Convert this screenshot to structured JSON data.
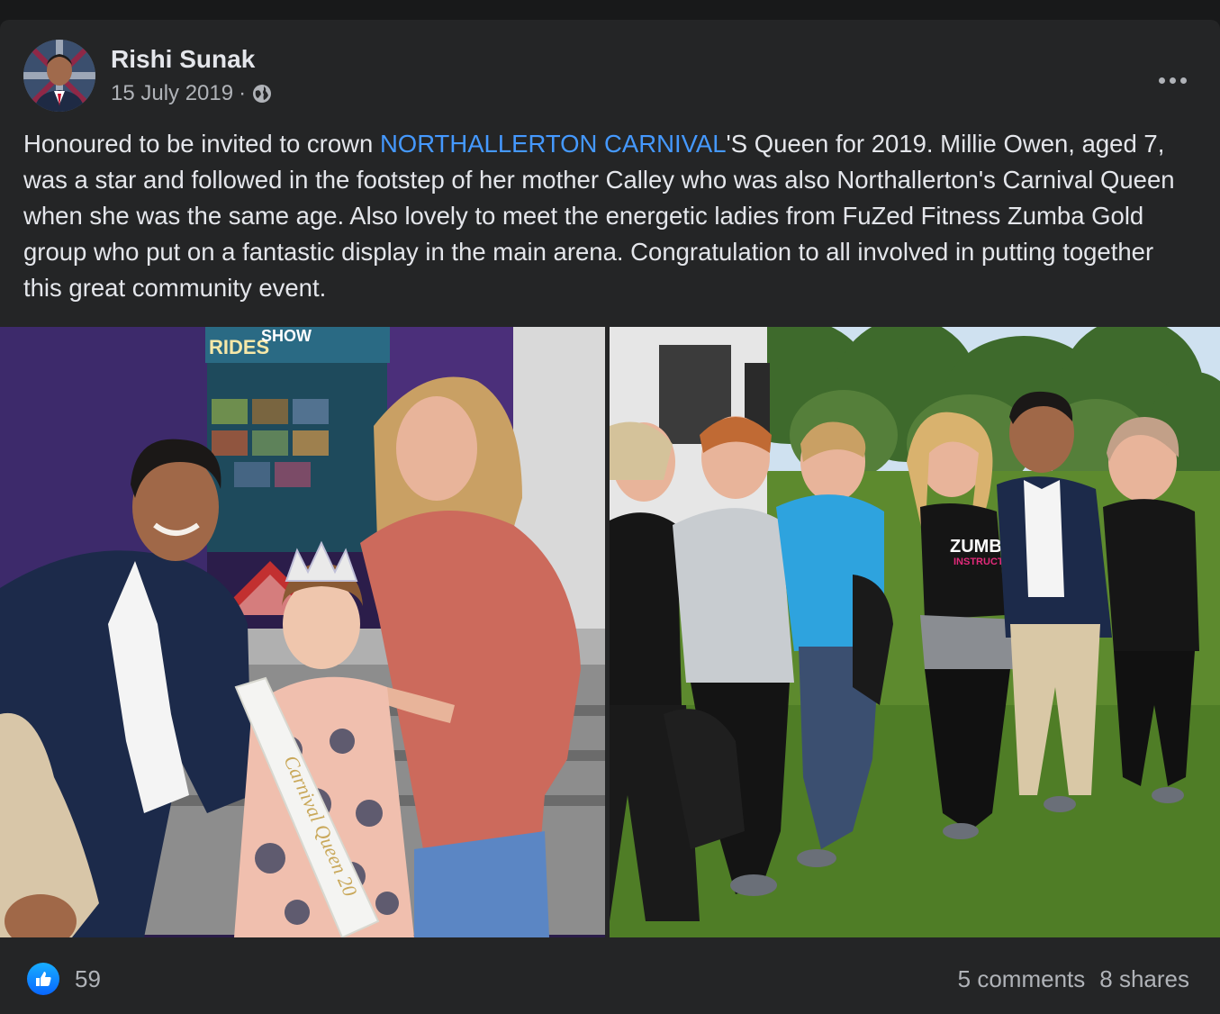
{
  "post": {
    "author": "Rishi Sunak",
    "date": "15 July 2019",
    "separator": "·",
    "privacy_icon": "globe-icon",
    "text_before_link": "Honoured to be invited to crown ",
    "link_text": "NORTHALLERTON CARNIVAL",
    "text_after_link": "'S Queen for 2019. Millie Owen, aged 7, was a star and followed in the footstep of her mother Calley who was also Northallerton's Carnival Queen when she was the same age. Also lovely to meet the energetic ladies from FuZed Fitness Zumba Gold group who put on a fantastic display in the main arena. Congratulation to all involved in putting together this great community event.",
    "photos": [
      {
        "signage": [
          "RIDES",
          "SHOW"
        ],
        "sash_text": "Carnival Queen 20"
      },
      {
        "shirt_text": [
          "ZUMBA",
          "INSTRUCTOR"
        ]
      }
    ]
  },
  "footer": {
    "reaction_icon": "like-icon",
    "like_count": "59",
    "comments": "5 comments",
    "shares": "8 shares"
  },
  "colors": {
    "background": "#18191a",
    "card": "#242526",
    "text": "#e4e6eb",
    "secondary": "#b0b3b8",
    "link": "#4599ff",
    "like_blue": "#0866ff"
  }
}
